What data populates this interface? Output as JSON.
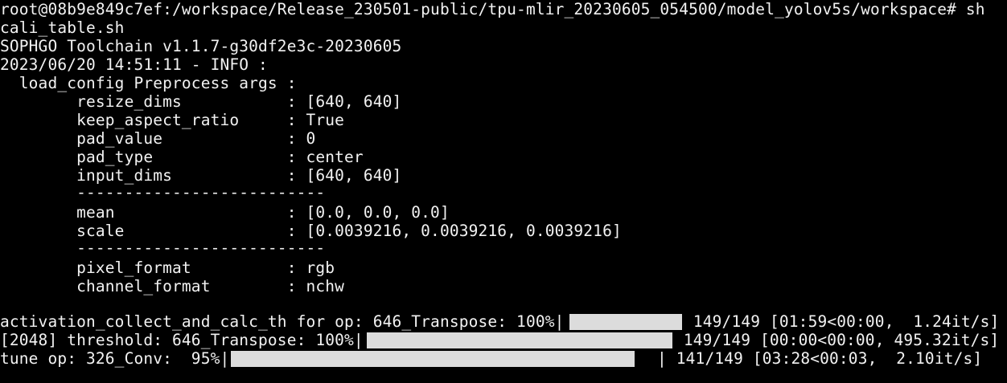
{
  "terminal": {
    "prompt_line": "root@08b9e849c7ef:/workspace/Release_230501-public/tpu-mlir_20230605_054500/model_yolov5s/workspace# sh",
    "command_cont": "cali_table.sh",
    "toolchain": "SOPHGO Toolchain v1.1.7-g30df2e3c-20230605",
    "log_header": "2023/06/20 14:51:11 - INFO :",
    "config_title": "  load_config Preprocess args :",
    "args_group1": [
      {
        "key": "resize_dims",
        "value": "[640, 640]"
      },
      {
        "key": "keep_aspect_ratio",
        "value": "True"
      },
      {
        "key": "pad_value",
        "value": "0"
      },
      {
        "key": "pad_type",
        "value": "center"
      },
      {
        "key": "input_dims",
        "value": "[640, 640]"
      }
    ],
    "separator": "--------------------------",
    "args_group2": [
      {
        "key": "mean",
        "value": "[0.0, 0.0, 0.0]"
      },
      {
        "key": "scale",
        "value": "[0.0039216, 0.0039216, 0.0039216]"
      }
    ],
    "args_group3": [
      {
        "key": "pixel_format",
        "value": "rgb"
      },
      {
        "key": "channel_format",
        "value": "nchw"
      }
    ],
    "progress": [
      {
        "label": "activation_collect_and_calc_th for op: 646_Transpose: 100%|",
        "fraction": 1.0,
        "count": " 149/149",
        "timing": " [01:59<00:00,  1.24it/s]"
      },
      {
        "label": "[2048] threshold: 646_Transpose: 100%|",
        "fraction": 1.0,
        "count": " 149/149",
        "timing": " [00:00<00:00, 495.32it/s]"
      },
      {
        "label": "tune op: 326_Conv:  95%|",
        "fraction": 0.95,
        "count": "| 141/149",
        "timing": " [03:28<00:03,  2.10it/s]"
      }
    ],
    "colors": {
      "background": "#000000",
      "foreground": "#f2f2f2",
      "bar_fill": "#dcdcdc"
    }
  }
}
